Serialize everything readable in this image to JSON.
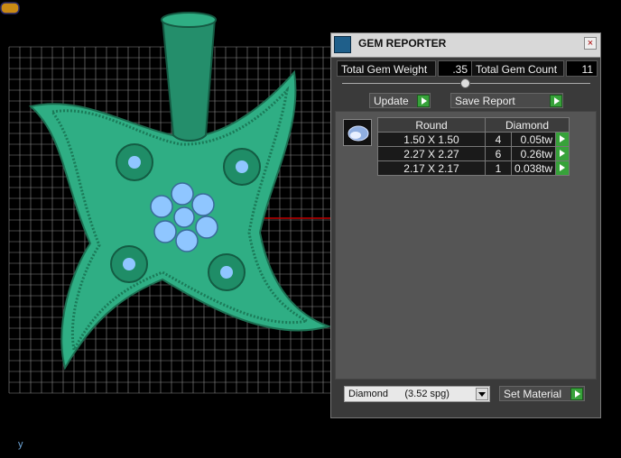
{
  "panel": {
    "title": "GEM REPORTER",
    "close_label": "×",
    "total_weight_label": "Total Gem Weight",
    "total_weight_value": ".35",
    "total_count_label": "Total Gem Count",
    "total_count_value": "11",
    "update_label": "Update",
    "save_report_label": "Save Report"
  },
  "gem_table": {
    "headers": [
      "Round",
      "Diamond"
    ],
    "rows": [
      {
        "size": "1.50 X 1.50",
        "count": "4",
        "weight": "0.05tw"
      },
      {
        "size": "2.27 X 2.27",
        "count": "6",
        "weight": "0.26tw"
      },
      {
        "size": "2.17 X 2.17",
        "count": "1",
        "weight": "0.038tw"
      }
    ]
  },
  "material": {
    "selected": "Diamond      (3.52 spg)",
    "set_label": "Set Material"
  },
  "viewport": {
    "axis_label": "y",
    "pendant_color": "#2fae84",
    "gem_color": "#8fc6ff"
  }
}
